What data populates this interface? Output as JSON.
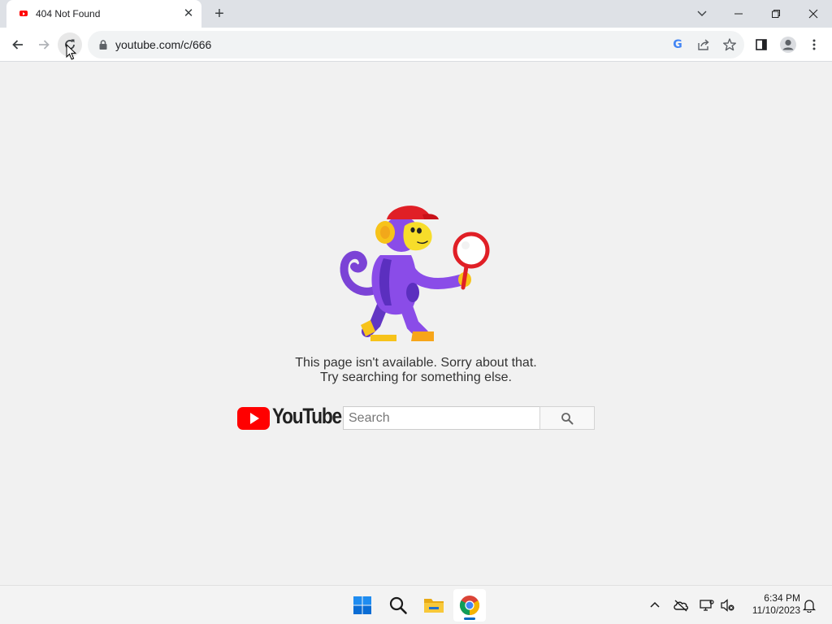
{
  "browser": {
    "tab": {
      "title": "404 Not Found",
      "favicon": "youtube-favicon-icon"
    },
    "address_bar": {
      "url": "youtube.com/c/666"
    },
    "icons": [
      "back-icon",
      "forward-icon",
      "reload-icon",
      "lock-icon",
      "google-lens-icon",
      "share-icon",
      "bookmark-star-icon",
      "side-panel-icon",
      "profile-icon",
      "menu-icon"
    ]
  },
  "page": {
    "illustration": "monkey-with-magnifier-illustration",
    "message_line1": "This page isn't available. Sorry about that.",
    "message_line2": "Try searching for something else.",
    "logo_text": "YouTube",
    "search": {
      "placeholder": "Search",
      "value": ""
    }
  },
  "taskbar": {
    "apps": [
      "windows-start-icon",
      "search-icon",
      "file-explorer-icon",
      "chrome-icon"
    ],
    "active_app": "chrome",
    "clock_time": "6:34 PM",
    "clock_date": "11/10/2023"
  },
  "colors": {
    "youtube_red": "#ff0000",
    "page_background": "#f1f1f1",
    "chrome_frame": "#dee1e6"
  }
}
